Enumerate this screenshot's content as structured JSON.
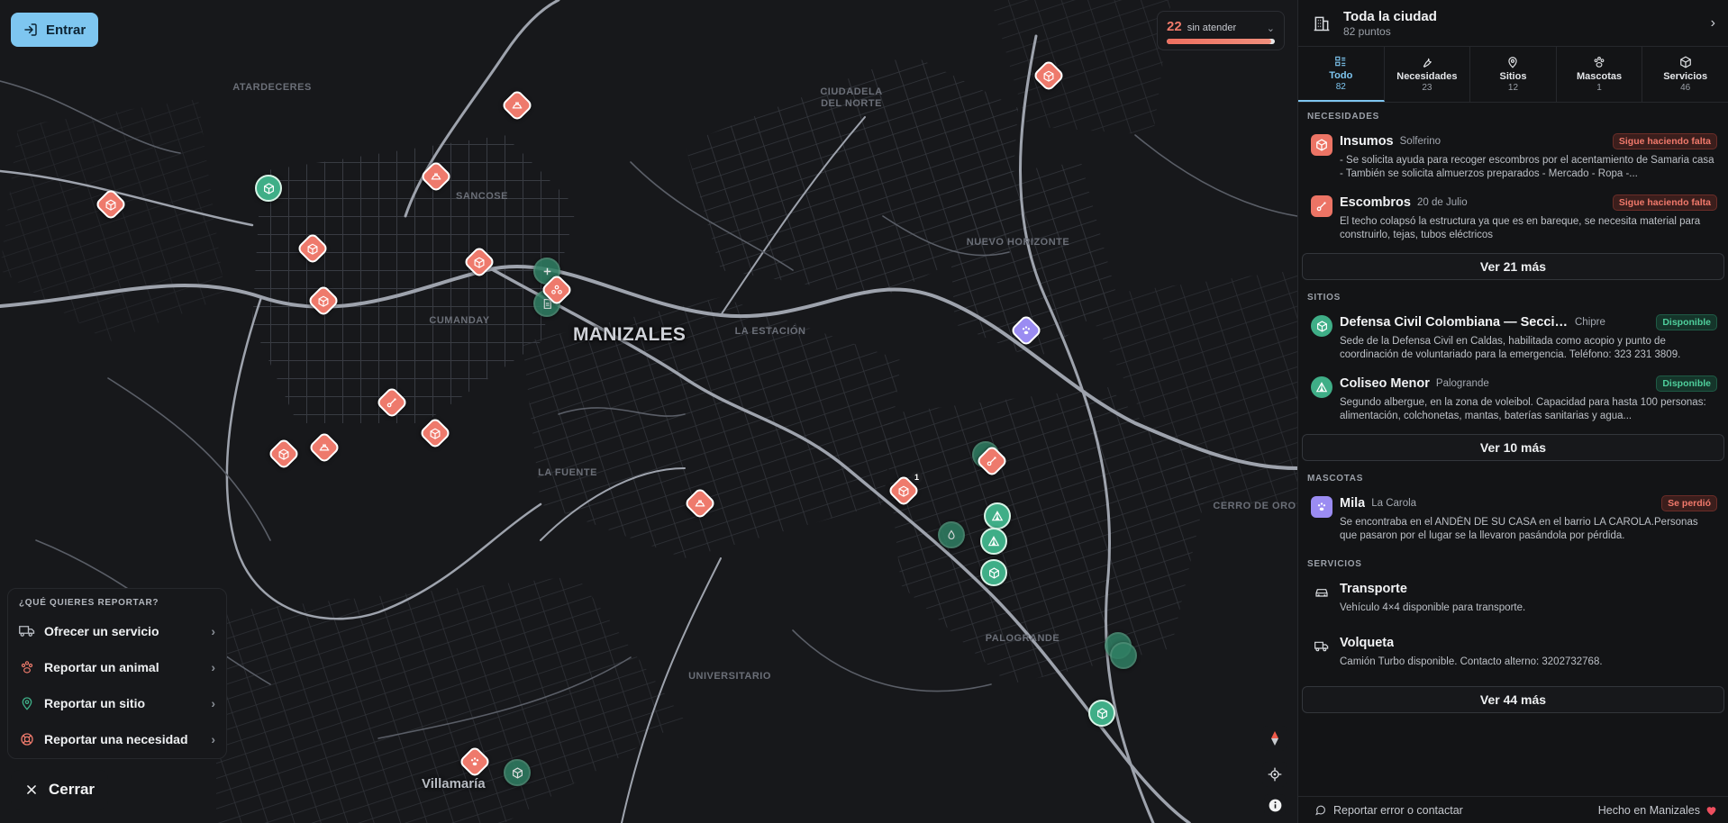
{
  "login": {
    "label": "Entrar"
  },
  "unattended": {
    "count": "22",
    "label": "sin atender",
    "fill_percent": 97
  },
  "map": {
    "city": "MANIZALES",
    "town": "Villamaría",
    "districts": [
      "ATARDECERES",
      "SANCOSE",
      "CUMANDAY",
      "LA ESTACIÓN",
      "CIUDADELA DEL NORTE",
      "NUEVO HORIZONTE",
      "LA FUENTE",
      "PALOGRANDE",
      "UNIVERSITARIO",
      "CERRO DE ORO"
    ],
    "marker_badge": "1"
  },
  "report": {
    "heading": "¿QUÉ QUIERES REPORTAR?",
    "items": [
      {
        "label": "Ofrecer un servicio",
        "icon": "truck-icon"
      },
      {
        "label": "Reportar un animal",
        "icon": "paw-icon"
      },
      {
        "label": "Reportar un sitio",
        "icon": "location-pin-icon"
      },
      {
        "label": "Reportar una necesidad",
        "icon": "lifebuoy-icon"
      }
    ]
  },
  "close": {
    "label": "Cerrar"
  },
  "panel": {
    "title": "Toda la ciudad",
    "subtitle": "82 puntos",
    "tabs": [
      {
        "label": "Todo",
        "count": "82"
      },
      {
        "label": "Necesidades",
        "count": "23"
      },
      {
        "label": "Sitios",
        "count": "12"
      },
      {
        "label": "Mascotas",
        "count": "1"
      },
      {
        "label": "Servicios",
        "count": "46"
      }
    ],
    "sections": {
      "needs": {
        "title": "NECESIDADES",
        "items": [
          {
            "title": "Insumos",
            "location": "Solferino",
            "status": "Sigue haciendo falta",
            "desc": "- Se solicita ayuda para recoger escombros por el acentamiento de Samaria casa - También se solicita almuerzos preparados - Mercado - Ropa -..."
          },
          {
            "title": "Escombros",
            "location": "20 de Julio",
            "status": "Sigue haciendo falta",
            "desc": "El techo colapsó la estructura ya que es en bareque, se necesita material para construirlo, tejas, tubos eléctricos"
          }
        ],
        "more": "Ver 21 más"
      },
      "sites": {
        "title": "SITIOS",
        "items": [
          {
            "title": "Defensa Civil Colombiana — Seccional Cal...",
            "location": "Chipre",
            "status": "Disponible",
            "desc": "Sede de la Defensa Civil en Caldas, habilitada como acopio y punto de coordinación de voluntariado para la emergencia. Teléfono: 323 231 3809."
          },
          {
            "title": "Coliseo Menor",
            "location": "Palogrande",
            "status": "Disponible",
            "desc": "Segundo albergue, en la zona de voleibol. Capacidad para hasta 100 personas: alimentación, colchonetas, mantas, baterías sanitarias y agua..."
          }
        ],
        "more": "Ver 10 más"
      },
      "pets": {
        "title": "MASCOTAS",
        "items": [
          {
            "title": "Mila",
            "location": "La Carola",
            "status": "Se perdió",
            "desc": "Se encontraba en el ANDÉN DE SU CASA en el barrio LA CAROLA.Personas que pasaron por el lugar se la llevaron pasándola por pérdida."
          }
        ]
      },
      "services": {
        "title": "SERVICIOS",
        "items": [
          {
            "title": "Transporte",
            "desc": "Vehículo 4×4 disponible para transporte."
          },
          {
            "title": "Volqueta",
            "desc": "Camión Turbo disponible. Contacto alterno: 3202732768."
          }
        ],
        "more": "Ver 44 más"
      }
    },
    "footer": {
      "report": "Reportar error o contactar",
      "made": "Hecho en Manizales"
    }
  }
}
